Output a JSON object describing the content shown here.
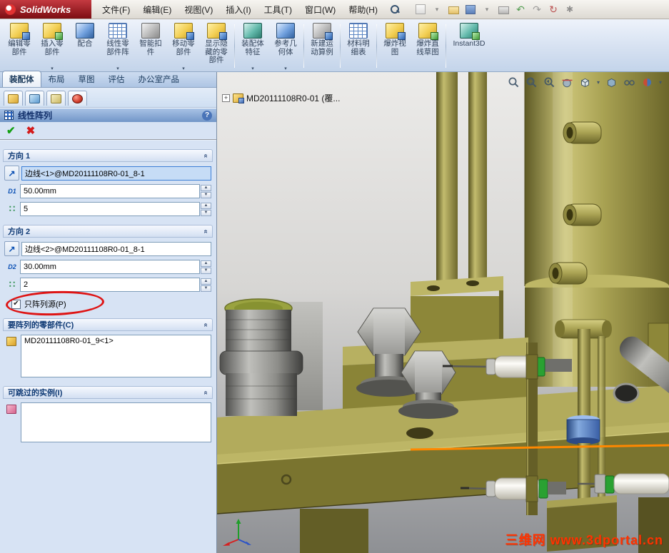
{
  "colors": {
    "model_olive": "#a8a152",
    "annotation_red": "#de1414",
    "orange_edge": "#ff8800",
    "sensor_green": "#2aa132",
    "collar_blue": "#4a7ad0",
    "pm_background": "#d7e3f4"
  },
  "titlebar": {
    "logo": "SolidWorks",
    "menu": [
      "文件(F)",
      "编辑(E)",
      "视图(V)",
      "插入(I)",
      "工具(T)",
      "窗口(W)",
      "帮助(H)"
    ]
  },
  "ribbon": {
    "buttons": [
      {
        "label": "编辑零部件"
      },
      {
        "label": "插入零部件"
      },
      {
        "label": "配合"
      },
      {
        "label": "线性零部件阵"
      },
      {
        "label": "智能扣件"
      },
      {
        "label": "移动零部件"
      },
      {
        "label": "显示隐藏的零部件"
      },
      {
        "label": "装配体特征"
      },
      {
        "label": "参考几何体"
      },
      {
        "label": "新建运动算例"
      },
      {
        "label": "材料明细表"
      },
      {
        "label": "爆炸视图"
      },
      {
        "label": "爆炸直线草图"
      },
      {
        "label": "Instant3D"
      }
    ]
  },
  "tabs": {
    "items": [
      {
        "label": "装配体"
      },
      {
        "label": "布局"
      },
      {
        "label": "草图"
      },
      {
        "label": "评估"
      },
      {
        "label": "办公室产品"
      }
    ],
    "active": "装配体"
  },
  "pm": {
    "title": "线性阵列",
    "help_label": "?",
    "dir1": {
      "header": "方向 1",
      "edge_ref": "边线<1>@MD20111108R0-01_8-1",
      "spacing": "50.00mm",
      "instances": "5"
    },
    "dir2": {
      "header": "方向 2",
      "edge_ref": "边线<2>@MD20111108R0-01_8-1",
      "spacing": "30.00mm",
      "instances": "2",
      "seed_only_label": "只阵列源(P)",
      "seed_only_checked": true
    },
    "components": {
      "header": "要阵列的零部件(C)",
      "items": [
        "MD20111108R0-01_9<1>"
      ]
    },
    "skip": {
      "header": "可跳过的实例(I)",
      "items": []
    }
  },
  "viewport": {
    "tree_node": "MD20111108R0-01 (覆...",
    "watermark": "三维网 www.3dportal.cn"
  }
}
